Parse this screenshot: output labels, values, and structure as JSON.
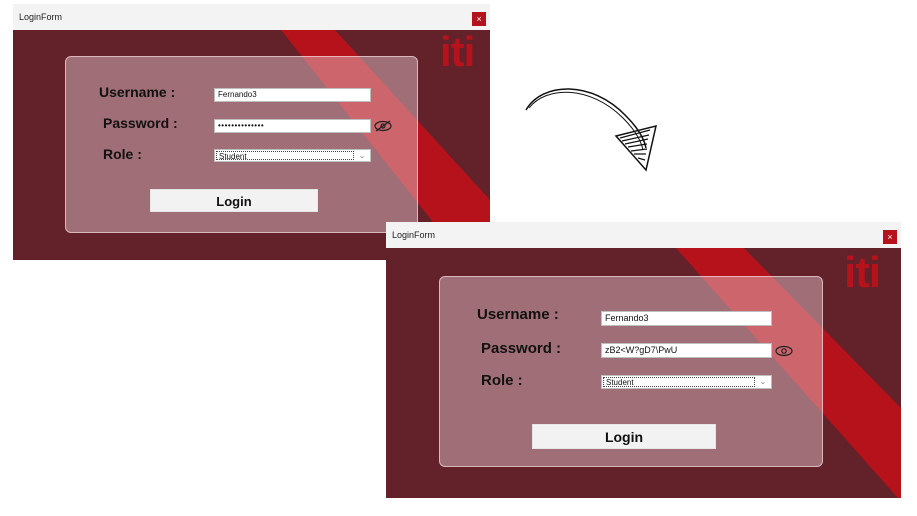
{
  "windows": [
    {
      "title": "LoginForm",
      "close_label": "×",
      "logo_text": "iti",
      "username_label": "Username :",
      "password_label": "Password :",
      "role_label": "Role :",
      "username_value": "Fernando3",
      "password_value": "••••••••••••••",
      "role_value": "Student",
      "login_label": "Login",
      "eye_icon": "eye-slash-icon"
    },
    {
      "title": "LoginForm",
      "close_label": "×",
      "logo_text": "iti",
      "username_label": "Username :",
      "password_label": "Password :",
      "role_label": "Role :",
      "username_value": "Fernando3",
      "password_value": "zB2<W?gD7\\PwU",
      "role_value": "Student",
      "login_label": "Login",
      "eye_icon": "eye-icon"
    }
  ],
  "colors": {
    "maroon": "#63212a",
    "red": "#b5121b",
    "panel": "#c8a7ac"
  }
}
